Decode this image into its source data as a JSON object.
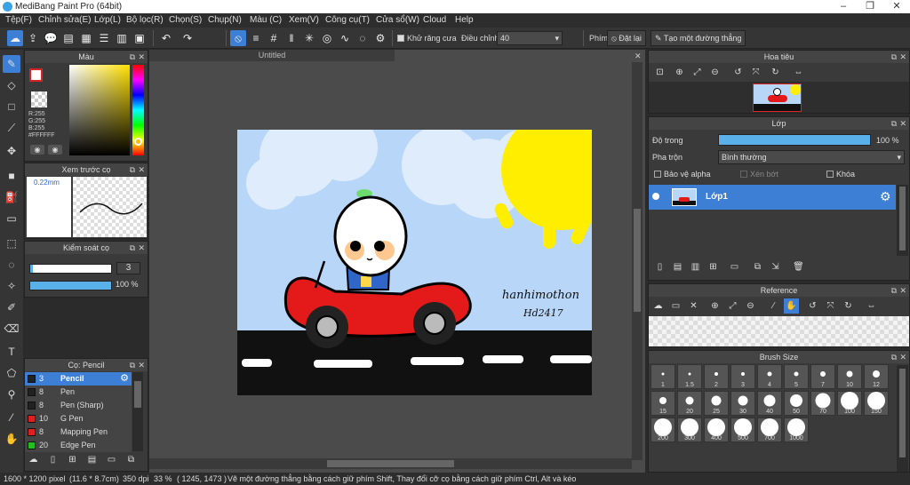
{
  "window": {
    "title": "MediBang Paint Pro (64bit)"
  },
  "menu": [
    "Tệp(F)",
    "Chỉnh sửa(E)",
    "Lớp(L)",
    "Bộ lọc(R)",
    "Chọn(S)",
    "Chụp(N)",
    "Màu (C)",
    "Xem(V)",
    "Công cụ(T)",
    "Cửa sổ(W)",
    "Cloud",
    "Help"
  ],
  "toolbar": {
    "antialias_label": "Khử răng cưa",
    "adjust_label": "Điều chỉnh",
    "adjust_value": "40",
    "key_label": "Phím",
    "reset_label": "Đặt lại",
    "make_line_label": "Tạo một đường thẳng"
  },
  "color_panel": {
    "title": "Màu",
    "r": "R:255",
    "g": "G:255",
    "b": "B:255",
    "hex": "#FFFFFF",
    "primary": "#ffffff",
    "secondary": "#ffffff"
  },
  "preview_panel": {
    "title": "Xem trước cọ",
    "size": "0.22mm"
  },
  "brush_control": {
    "title": "Kiểm soát cọ",
    "size_value": "3",
    "opacity_value": "100 %"
  },
  "brush_panel": {
    "title": "Cọ: Pencil",
    "items": [
      {
        "size": "3",
        "name": "Pencil",
        "color": "#222222",
        "selected": true
      },
      {
        "size": "8",
        "name": "Pen",
        "color": "#222222",
        "selected": false
      },
      {
        "size": "8",
        "name": "Pen (Sharp)",
        "color": "#222222",
        "selected": false
      },
      {
        "size": "10",
        "name": "G Pen",
        "color": "#e02020",
        "selected": false
      },
      {
        "size": "8",
        "name": "Mapping Pen",
        "color": "#e02020",
        "selected": false
      },
      {
        "size": "20",
        "name": "Edge Pen",
        "color": "#20c020",
        "selected": false
      }
    ]
  },
  "document": {
    "tab_title": "Untitled",
    "signature": "hanhimothon",
    "signature2": "Hd2417"
  },
  "navigator": {
    "title": "Hoa tiêu"
  },
  "layer_panel": {
    "title": "Lớp",
    "opacity_label": "Độ trong",
    "opacity_value": "100 %",
    "blend_label": "Pha trộn",
    "blend_value": "Bình thường",
    "protect_alpha": "Bảo vệ alpha",
    "clipping": "Xén bớt",
    "lock": "Khóa",
    "layers": [
      {
        "name": "Lớp1"
      }
    ]
  },
  "reference": {
    "title": "Reference"
  },
  "brush_size": {
    "title": "Brush Size",
    "sizes": [
      "1",
      "1.5",
      "2",
      "3",
      "4",
      "5",
      "7",
      "10",
      "12",
      "15",
      "20",
      "25",
      "30",
      "40",
      "50",
      "70",
      "100",
      "150",
      "200",
      "300",
      "400",
      "500",
      "700",
      "1000"
    ]
  },
  "status": {
    "dims": "1600 * 1200 pixel",
    "physical": "(11.6 * 8.7cm)",
    "dpi": "350 dpi",
    "zoom": "33 %",
    "coords": "( 1245, 1473 )",
    "hint": "Vẽ một đường thẳng bằng cách giữ phím Shift, Thay đổi cỡ cọ bằng cách giữ phím Ctrl, Alt và kéo"
  }
}
